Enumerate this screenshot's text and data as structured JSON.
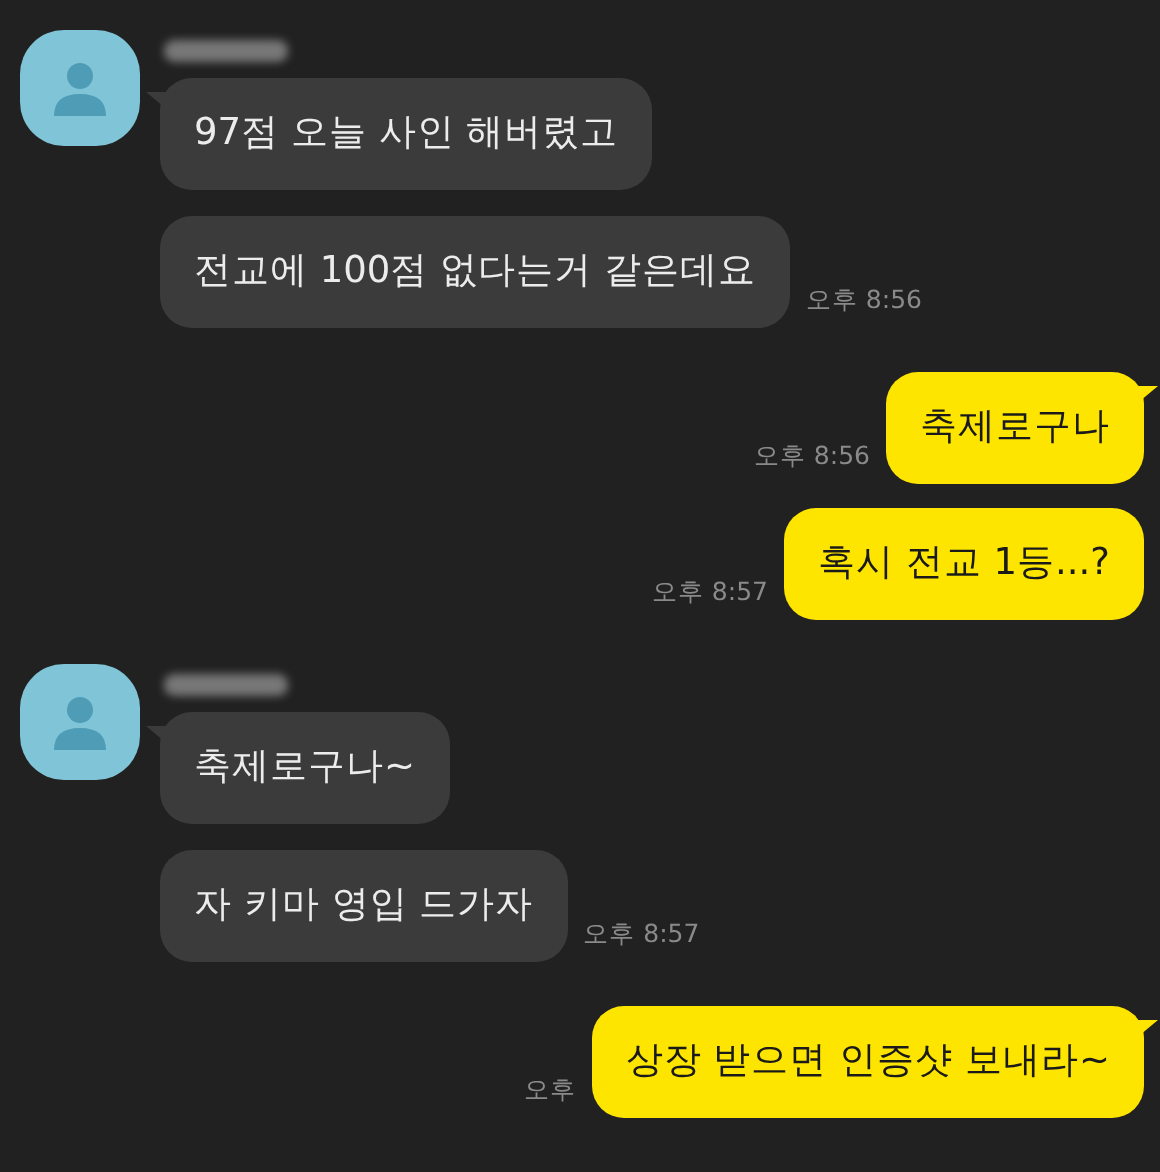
{
  "groups": [
    {
      "kind": "received",
      "messages": [
        {
          "text": "97점 오늘 사인 해버렸고"
        },
        {
          "text": "전교에 100점 없다는거 같은데요",
          "time": "오후 8:56"
        }
      ]
    },
    {
      "kind": "sent",
      "messages": [
        {
          "text": "축제로구나",
          "time": "오후 8:56"
        },
        {
          "text": "혹시 전교 1등...?",
          "time": "오후 8:57"
        }
      ]
    },
    {
      "kind": "received",
      "messages": [
        {
          "text": "축제로구나~"
        },
        {
          "text": "자 키마 영입 드가자",
          "time": "오후 8:57"
        }
      ]
    },
    {
      "kind": "sent",
      "messages": [
        {
          "text": "상장 받으면 인증샷 보내라~",
          "time": "오후"
        }
      ]
    }
  ]
}
